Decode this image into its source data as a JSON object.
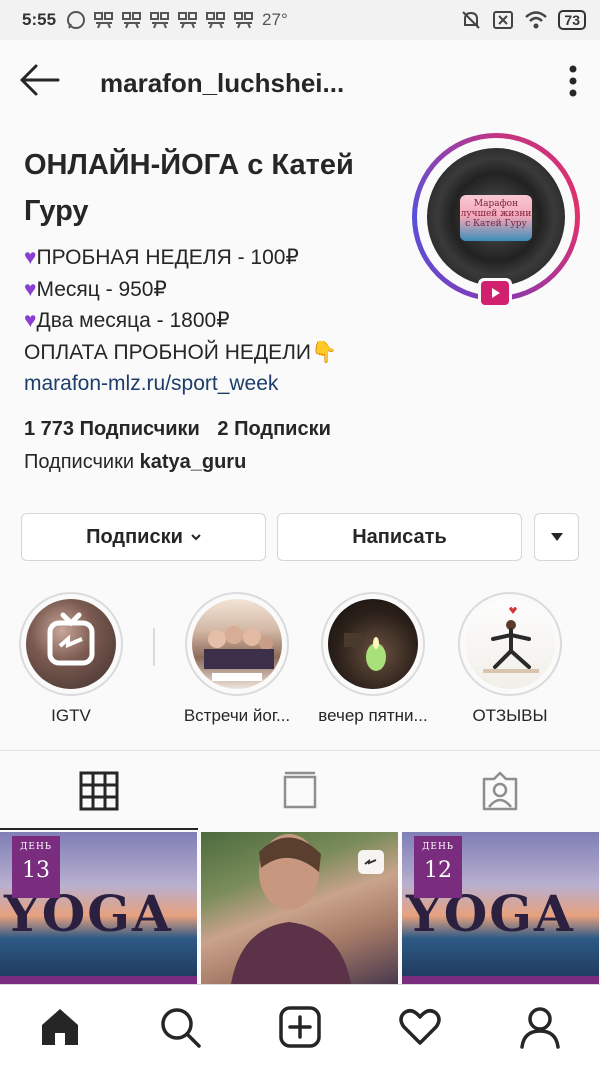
{
  "status_bar": {
    "time": "5:55",
    "temperature": "27°",
    "battery": "73"
  },
  "header": {
    "username": "marafon_luchshei..."
  },
  "profile": {
    "name": "ОНЛАЙН-ЙОГА с Катей Гуру",
    "avatar_text": "Марафон лучшей жизни с Катей Гуру",
    "bio_lines": [
      "ПРОБНАЯ НЕДЕЛЯ - 100₽",
      "Месяц - 950₽",
      "Два месяца - 1800₽"
    ],
    "bio_payment": "ОПЛАТА ПРОБНОЙ НЕДЕЛИ👇",
    "bio_link": "marafon-mlz.ru/sport_week",
    "followers": "1 773 Подписчики",
    "following": "2 Подписки",
    "followed_by_prefix": "Подписчики",
    "followed_by_user": "katya_guru"
  },
  "buttons": {
    "subscriptions": "Подписки",
    "message": "Написать"
  },
  "highlights": [
    {
      "label": "IGTV"
    },
    {
      "label": "Встречи йог..."
    },
    {
      "label": "вечер пятни..."
    },
    {
      "label": "ОТЗЫВЫ"
    }
  ],
  "posts": [
    {
      "day_label": "ДЕНЬ",
      "day": "13",
      "word": "YOGA"
    },
    {
      "type": "video"
    },
    {
      "day_label": "ДЕНЬ",
      "day": "12",
      "word": "YOGA"
    }
  ],
  "colors": {
    "accent_ring": "#c13584",
    "heart": "#8a3fd1",
    "link": "#1d3d6b",
    "igtv_badge": "#d1206e"
  }
}
